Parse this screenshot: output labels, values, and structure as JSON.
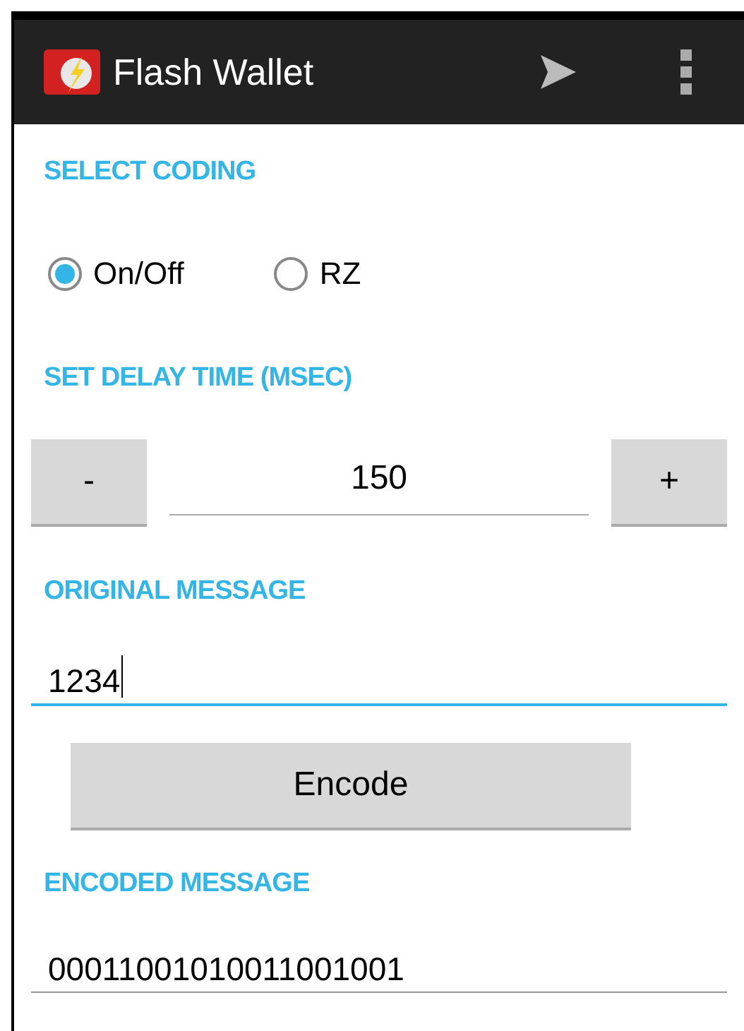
{
  "app_bar": {
    "title": "Flash Wallet"
  },
  "coding": {
    "label": "SELECT CODING",
    "options": [
      {
        "label": "On/Off",
        "selected": true
      },
      {
        "label": "RZ",
        "selected": false
      }
    ]
  },
  "delay": {
    "label": "SET DELAY TIME (MSEC)",
    "decrement": "-",
    "value": "150",
    "increment": "+"
  },
  "original": {
    "label": "ORIGINAL MESSAGE",
    "value": "1234",
    "focused": true
  },
  "encode_button": "Encode",
  "encoded": {
    "label": "ENCODED MESSAGE",
    "value": "00011001010011001001",
    "focused": false
  }
}
